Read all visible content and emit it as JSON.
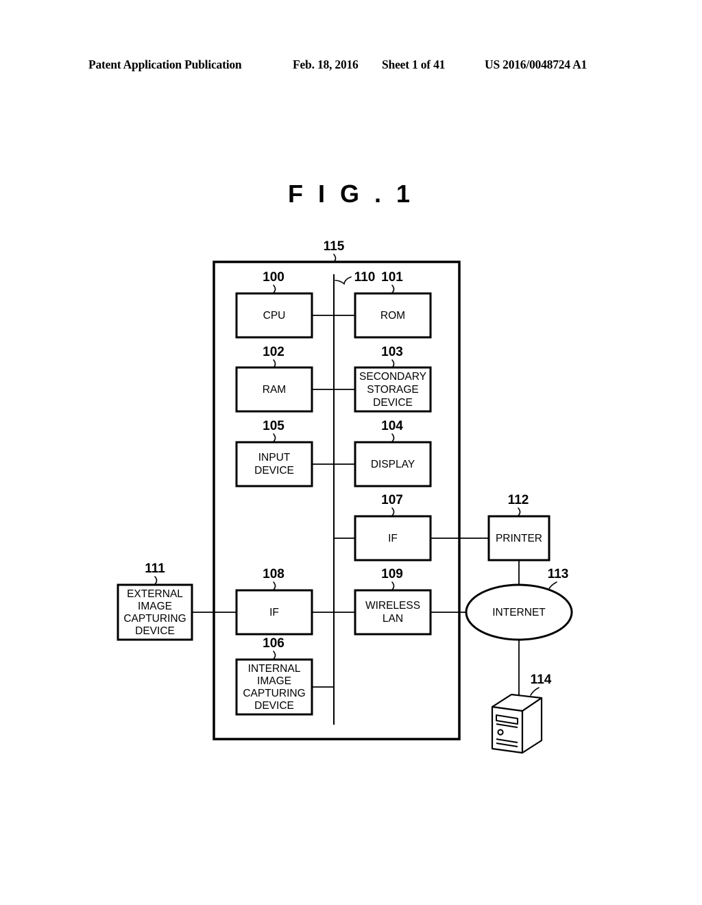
{
  "header": {
    "publication": "Patent Application Publication",
    "date": "Feb. 18, 2016",
    "sheet": "Sheet 1 of 41",
    "document_number": "US 2016/0048724 A1"
  },
  "figure": {
    "title": "F I G .  1"
  },
  "diagram": {
    "system_ref": "115",
    "bus_ref": "110",
    "blocks": [
      {
        "ref": "100",
        "label_lines": [
          "CPU"
        ]
      },
      {
        "ref": "101",
        "label_lines": [
          "ROM"
        ]
      },
      {
        "ref": "102",
        "label_lines": [
          "RAM"
        ]
      },
      {
        "ref": "103",
        "label_lines": [
          "SECONDARY",
          "STORAGE",
          "DEVICE"
        ]
      },
      {
        "ref": "104",
        "label_lines": [
          "DISPLAY"
        ]
      },
      {
        "ref": "105",
        "label_lines": [
          "INPUT",
          "DEVICE"
        ]
      },
      {
        "ref": "106",
        "label_lines": [
          "INTERNAL",
          "IMAGE",
          "CAPTURING",
          "DEVICE"
        ]
      },
      {
        "ref": "107",
        "label_lines": [
          "IF"
        ]
      },
      {
        "ref": "108",
        "label_lines": [
          "IF"
        ]
      },
      {
        "ref": "109",
        "label_lines": [
          "WIRELESS",
          "LAN"
        ]
      },
      {
        "ref": "111",
        "label_lines": [
          "EXTERNAL",
          "IMAGE",
          "CAPTURING",
          "DEVICE"
        ]
      },
      {
        "ref": "112",
        "label_lines": [
          "PRINTER"
        ]
      },
      {
        "ref": "113",
        "label_lines": [
          "INTERNET"
        ]
      },
      {
        "ref": "114",
        "label_lines": []
      }
    ],
    "labels": {
      "cpu": "CPU",
      "rom": "ROM",
      "ram": "RAM",
      "secondary_storage_1": "SECONDARY",
      "secondary_storage_2": "STORAGE",
      "secondary_storage_3": "DEVICE",
      "input_device_1": "INPUT",
      "input_device_2": "DEVICE",
      "display": "DISPLAY",
      "if_107": "IF",
      "if_108": "IF",
      "wireless_lan_1": "WIRELESS",
      "wireless_lan_2": "LAN",
      "internal_cam_1": "INTERNAL",
      "internal_cam_2": "IMAGE",
      "internal_cam_3": "CAPTURING",
      "internal_cam_4": "DEVICE",
      "external_cam_1": "EXTERNAL",
      "external_cam_2": "IMAGE",
      "external_cam_3": "CAPTURING",
      "external_cam_4": "DEVICE",
      "printer": "PRINTER",
      "internet": "INTERNET"
    },
    "refs": {
      "r100": "100",
      "r101": "101",
      "r102": "102",
      "r103": "103",
      "r104": "104",
      "r105": "105",
      "r106": "106",
      "r107": "107",
      "r108": "108",
      "r109": "109",
      "r110": "110",
      "r111": "111",
      "r112": "112",
      "r113": "113",
      "r114": "114",
      "r115": "115"
    }
  },
  "colors": {
    "ink": "#000000",
    "paper": "#ffffff"
  }
}
